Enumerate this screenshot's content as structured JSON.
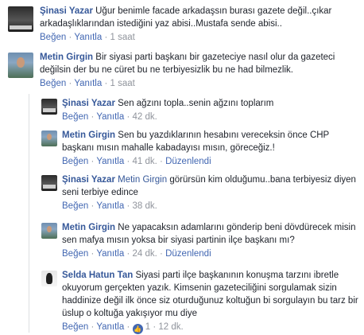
{
  "labels": {
    "like": "Beğen",
    "reply": "Yanıtla",
    "edited": "Düzenlendi",
    "dot": "·"
  },
  "comments": [
    {
      "author": "Şinasi Yazar",
      "text": "Uğur benimle facade arkadaşsın burası gazete değil..çıkar arkadaşlıklarından istediğini yaz abisi..Mustafa sende abisi..",
      "time": "1 saat"
    },
    {
      "author": "Metin Girgin",
      "text": "Bir siyasi parti başkanı bir gazeteciye nasıl olur da gazeteci değilsin der bu ne cüret bu ne terbiyesizlik bu ne had bilmezlik.",
      "time": "1 saat"
    },
    {
      "author": "Şinasi Yazar",
      "text": "Sen ağzını topla..senin ağzını toplarım",
      "time": "42 dk."
    },
    {
      "author": "Metin Girgin",
      "text": "Sen bu yazdıklarının hesabını vereceksin önce CHP başkanı mısın mahalle kabadayısı mısın, göreceğiz.!",
      "time": "41 dk."
    },
    {
      "author": "Şinasi Yazar",
      "mention": "Metin Girgin",
      "text": "görürsün kim olduğumu..bana terbiyesiz diyen seni terbiye edince",
      "time": "38 dk."
    },
    {
      "author": "Metin Girgin",
      "text": "Ne yapacaksın adamlarını gönderip beni dövdürecek misin sen mafya mısın yoksa bir siyasi partinin ilçe başkanı mı?",
      "time": "24 dk."
    },
    {
      "author": "Selda Hatun Tan",
      "text": "Siyasi parti ilçe başkanının konuşma tarzını ibretle okuyorum gerçekten yazık. Kimsenin gazeteciliğini sorgulamak sizin haddinize değil ilk önce siz oturduğunuz koltuğun bi sorgulayın bu tarz bir üslup o koltuğa yakışıyor mu diye",
      "time": "12 dk.",
      "likes": "1"
    }
  ],
  "icons": {
    "like_badge": "thumbs-up-icon"
  },
  "colors": {
    "link": "#365899",
    "meta": "#90949c",
    "like_badge": "#4267b2"
  }
}
